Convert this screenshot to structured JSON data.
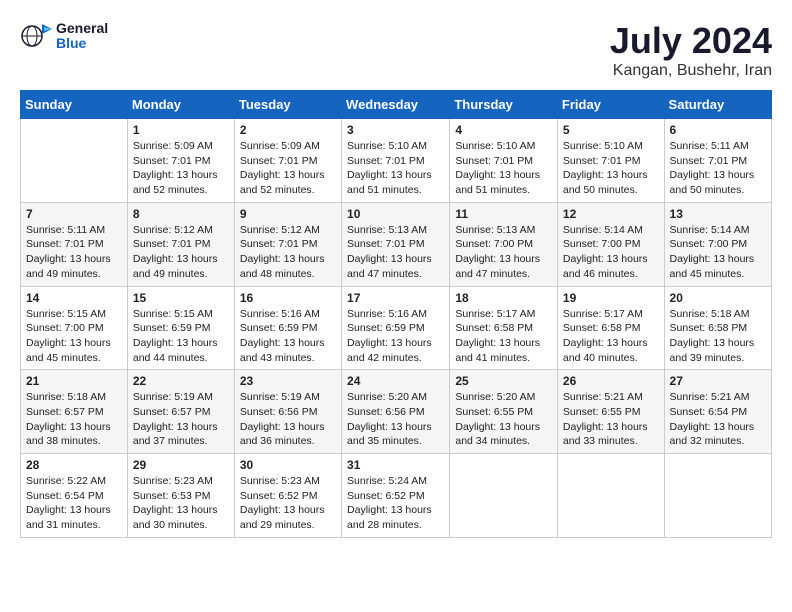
{
  "logo": {
    "line1": "General",
    "line2": "Blue"
  },
  "title": "July 2024",
  "subtitle": "Kangan, Bushehr, Iran",
  "days_header": [
    "Sunday",
    "Monday",
    "Tuesday",
    "Wednesday",
    "Thursday",
    "Friday",
    "Saturday"
  ],
  "weeks": [
    [
      {
        "day": "",
        "info": ""
      },
      {
        "day": "1",
        "info": "Sunrise: 5:09 AM\nSunset: 7:01 PM\nDaylight: 13 hours\nand 52 minutes."
      },
      {
        "day": "2",
        "info": "Sunrise: 5:09 AM\nSunset: 7:01 PM\nDaylight: 13 hours\nand 52 minutes."
      },
      {
        "day": "3",
        "info": "Sunrise: 5:10 AM\nSunset: 7:01 PM\nDaylight: 13 hours\nand 51 minutes."
      },
      {
        "day": "4",
        "info": "Sunrise: 5:10 AM\nSunset: 7:01 PM\nDaylight: 13 hours\nand 51 minutes."
      },
      {
        "day": "5",
        "info": "Sunrise: 5:10 AM\nSunset: 7:01 PM\nDaylight: 13 hours\nand 50 minutes."
      },
      {
        "day": "6",
        "info": "Sunrise: 5:11 AM\nSunset: 7:01 PM\nDaylight: 13 hours\nand 50 minutes."
      }
    ],
    [
      {
        "day": "7",
        "info": "Sunrise: 5:11 AM\nSunset: 7:01 PM\nDaylight: 13 hours\nand 49 minutes."
      },
      {
        "day": "8",
        "info": "Sunrise: 5:12 AM\nSunset: 7:01 PM\nDaylight: 13 hours\nand 49 minutes."
      },
      {
        "day": "9",
        "info": "Sunrise: 5:12 AM\nSunset: 7:01 PM\nDaylight: 13 hours\nand 48 minutes."
      },
      {
        "day": "10",
        "info": "Sunrise: 5:13 AM\nSunset: 7:01 PM\nDaylight: 13 hours\nand 47 minutes."
      },
      {
        "day": "11",
        "info": "Sunrise: 5:13 AM\nSunset: 7:00 PM\nDaylight: 13 hours\nand 47 minutes."
      },
      {
        "day": "12",
        "info": "Sunrise: 5:14 AM\nSunset: 7:00 PM\nDaylight: 13 hours\nand 46 minutes."
      },
      {
        "day": "13",
        "info": "Sunrise: 5:14 AM\nSunset: 7:00 PM\nDaylight: 13 hours\nand 45 minutes."
      }
    ],
    [
      {
        "day": "14",
        "info": "Sunrise: 5:15 AM\nSunset: 7:00 PM\nDaylight: 13 hours\nand 45 minutes."
      },
      {
        "day": "15",
        "info": "Sunrise: 5:15 AM\nSunset: 6:59 PM\nDaylight: 13 hours\nand 44 minutes."
      },
      {
        "day": "16",
        "info": "Sunrise: 5:16 AM\nSunset: 6:59 PM\nDaylight: 13 hours\nand 43 minutes."
      },
      {
        "day": "17",
        "info": "Sunrise: 5:16 AM\nSunset: 6:59 PM\nDaylight: 13 hours\nand 42 minutes."
      },
      {
        "day": "18",
        "info": "Sunrise: 5:17 AM\nSunset: 6:58 PM\nDaylight: 13 hours\nand 41 minutes."
      },
      {
        "day": "19",
        "info": "Sunrise: 5:17 AM\nSunset: 6:58 PM\nDaylight: 13 hours\nand 40 minutes."
      },
      {
        "day": "20",
        "info": "Sunrise: 5:18 AM\nSunset: 6:58 PM\nDaylight: 13 hours\nand 39 minutes."
      }
    ],
    [
      {
        "day": "21",
        "info": "Sunrise: 5:18 AM\nSunset: 6:57 PM\nDaylight: 13 hours\nand 38 minutes."
      },
      {
        "day": "22",
        "info": "Sunrise: 5:19 AM\nSunset: 6:57 PM\nDaylight: 13 hours\nand 37 minutes."
      },
      {
        "day": "23",
        "info": "Sunrise: 5:19 AM\nSunset: 6:56 PM\nDaylight: 13 hours\nand 36 minutes."
      },
      {
        "day": "24",
        "info": "Sunrise: 5:20 AM\nSunset: 6:56 PM\nDaylight: 13 hours\nand 35 minutes."
      },
      {
        "day": "25",
        "info": "Sunrise: 5:20 AM\nSunset: 6:55 PM\nDaylight: 13 hours\nand 34 minutes."
      },
      {
        "day": "26",
        "info": "Sunrise: 5:21 AM\nSunset: 6:55 PM\nDaylight: 13 hours\nand 33 minutes."
      },
      {
        "day": "27",
        "info": "Sunrise: 5:21 AM\nSunset: 6:54 PM\nDaylight: 13 hours\nand 32 minutes."
      }
    ],
    [
      {
        "day": "28",
        "info": "Sunrise: 5:22 AM\nSunset: 6:54 PM\nDaylight: 13 hours\nand 31 minutes."
      },
      {
        "day": "29",
        "info": "Sunrise: 5:23 AM\nSunset: 6:53 PM\nDaylight: 13 hours\nand 30 minutes."
      },
      {
        "day": "30",
        "info": "Sunrise: 5:23 AM\nSunset: 6:52 PM\nDaylight: 13 hours\nand 29 minutes."
      },
      {
        "day": "31",
        "info": "Sunrise: 5:24 AM\nSunset: 6:52 PM\nDaylight: 13 hours\nand 28 minutes."
      },
      {
        "day": "",
        "info": ""
      },
      {
        "day": "",
        "info": ""
      },
      {
        "day": "",
        "info": ""
      }
    ]
  ]
}
